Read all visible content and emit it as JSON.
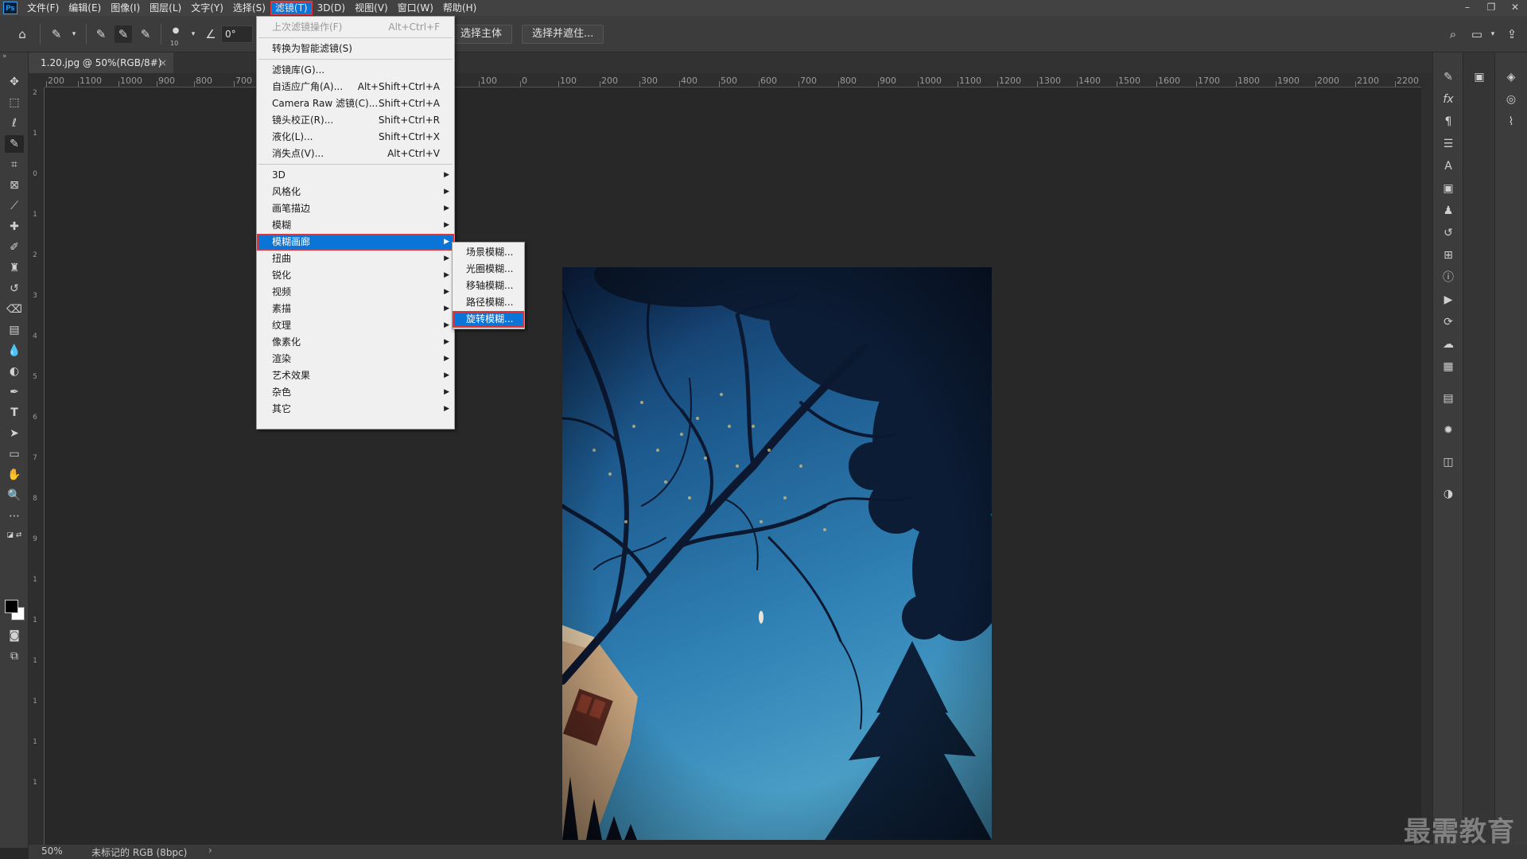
{
  "menubar": {
    "logo": "Ps",
    "items": [
      {
        "label": "文件(F)",
        "name": "menu-file"
      },
      {
        "label": "编辑(E)",
        "name": "menu-edit"
      },
      {
        "label": "图像(I)",
        "name": "menu-image"
      },
      {
        "label": "图层(L)",
        "name": "menu-layer"
      },
      {
        "label": "文字(Y)",
        "name": "menu-type"
      },
      {
        "label": "选择(S)",
        "name": "menu-select"
      },
      {
        "label": "滤镜(T)",
        "name": "menu-filter"
      },
      {
        "label": "3D(D)",
        "name": "menu-3d"
      },
      {
        "label": "视图(V)",
        "name": "menu-view"
      },
      {
        "label": "窗口(W)",
        "name": "menu-window"
      },
      {
        "label": "帮助(H)",
        "name": "menu-help"
      }
    ],
    "active_index": 6
  },
  "window_controls": {
    "minimize": "–",
    "restore": "❐",
    "close": "✕"
  },
  "options_bar": {
    "brush_size": "10",
    "angle_value": "0°",
    "select_subject": "选择主体",
    "select_and_mask": "选择并遮住..."
  },
  "document_tab": {
    "title": "1.20.jpg @ 50%(RGB/8#)",
    "close": "×"
  },
  "ruler": {
    "horizontal": [
      "200",
      "1100",
      "1000",
      "900",
      "800",
      "700",
      "100",
      "0",
      "100",
      "200",
      "300",
      "400",
      "500",
      "600",
      "700",
      "800",
      "900",
      "1000",
      "1100",
      "1200",
      "1300",
      "1400",
      "1500",
      "1600",
      "1700",
      "1800",
      "1900",
      "2000",
      "2100",
      "2200"
    ],
    "vertical": [
      "2",
      "1",
      "0",
      "1",
      "2",
      "3",
      "4",
      "5",
      "6",
      "7",
      "8",
      "9",
      "1",
      "1",
      "1",
      "1",
      "1",
      "1"
    ]
  },
  "filter_menu": {
    "items": [
      {
        "label": "上次滤镜操作(F)",
        "shortcut": "Alt+Ctrl+F",
        "disabled": true
      },
      {
        "sep": true
      },
      {
        "label": "转换为智能滤镜(S)",
        "shortcut": ""
      },
      {
        "sep": true
      },
      {
        "label": "滤镜库(G)...",
        "shortcut": ""
      },
      {
        "label": "自适应广角(A)...",
        "shortcut": "Alt+Shift+Ctrl+A"
      },
      {
        "label": "Camera Raw 滤镜(C)...",
        "shortcut": "Shift+Ctrl+A"
      },
      {
        "label": "镜头校正(R)...",
        "shortcut": "Shift+Ctrl+R"
      },
      {
        "label": "液化(L)...",
        "shortcut": "Shift+Ctrl+X"
      },
      {
        "label": "消失点(V)...",
        "shortcut": "Alt+Ctrl+V"
      },
      {
        "sep": true
      },
      {
        "label": "3D",
        "submenu": true
      },
      {
        "label": "风格化",
        "submenu": true
      },
      {
        "label": "画笔描边",
        "submenu": true
      },
      {
        "label": "模糊",
        "submenu": true
      },
      {
        "label": "模糊画廊",
        "submenu": true,
        "highlighted": true
      },
      {
        "label": "扭曲",
        "submenu": true
      },
      {
        "label": "锐化",
        "submenu": true
      },
      {
        "label": "视频",
        "submenu": true
      },
      {
        "label": "素描",
        "submenu": true
      },
      {
        "label": "纹理",
        "submenu": true
      },
      {
        "label": "像素化",
        "submenu": true
      },
      {
        "label": "渲染",
        "submenu": true
      },
      {
        "label": "艺术效果",
        "submenu": true
      },
      {
        "label": "杂色",
        "submenu": true
      },
      {
        "label": "其它",
        "submenu": true
      }
    ]
  },
  "blur_gallery_submenu": {
    "items": [
      {
        "label": "场景模糊..."
      },
      {
        "label": "光圈模糊..."
      },
      {
        "label": "移轴模糊..."
      },
      {
        "label": "路径模糊..."
      },
      {
        "label": "旋转模糊...",
        "highlighted": true
      }
    ]
  },
  "status_bar": {
    "zoom": "50%",
    "doc_info": "未标记的 RGB (8bpc)",
    "arrow": "›"
  },
  "watermark": "最需教育",
  "colors": {
    "menu_highlight": "#0b74d7",
    "highlight_outline": "#e23434",
    "sky_top": "#0e2a55",
    "sky_bottom": "#3f95c0"
  }
}
